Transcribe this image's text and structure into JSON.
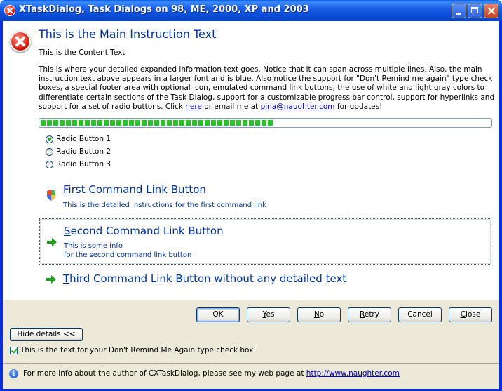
{
  "window": {
    "title": "XTaskDialog, Task Dialogs on 98, ME, 2000, XP and 2003"
  },
  "main": {
    "instruction": "This is the Main Instruction Text",
    "content": "This is the Content Text",
    "expanded_before": "This is where your detailed expanded information text goes. Notice that it can span across multiple lines. Also, the main instruction text above appears in a larger font and is blue. Also notice the support for \"Don't Remind me again\" type check boxes, a special footer area with optional icon, emulated command link buttons, the use of white and light gray colors to differentiate certain sections of the Task Dialog, support for a customizable progress bar control, support for hyperlinks and support for a set of radio buttons. Click ",
    "link_here": "here",
    "expanded_middle": " or email me at ",
    "link_email": "pjna@naughter.com",
    "expanded_after": " for updates!",
    "progress": 0.52
  },
  "radios": [
    {
      "label": "Radio Button 1",
      "checked": true
    },
    {
      "label": "Radio Button 2",
      "checked": false
    },
    {
      "label": "Radio Button 3",
      "checked": false
    }
  ],
  "commands": [
    {
      "access_key": "F",
      "title_rest": "irst Command Link Button",
      "detail1": "This is the detailed instructions for the first command link",
      "icon": "shield-icon"
    },
    {
      "access_key": "S",
      "title_rest": "econd Command Link Button",
      "detail1": "This is some info",
      "detail2": "for the second command link button",
      "icon": "arrow-icon"
    },
    {
      "access_key": "T",
      "title_rest": "hird Command Link Button without any detailed text",
      "icon": "arrow-icon"
    }
  ],
  "buttons": [
    {
      "pre": "OK",
      "key": "",
      "post": ""
    },
    {
      "pre": "",
      "key": "Y",
      "post": "es"
    },
    {
      "pre": "",
      "key": "N",
      "post": "o"
    },
    {
      "pre": "",
      "key": "R",
      "post": "etry"
    },
    {
      "pre": "Cancel",
      "key": "",
      "post": ""
    },
    {
      "pre": "",
      "key": "C",
      "post": "lose"
    }
  ],
  "details_button": "Hide details <<",
  "verification": {
    "label": "This is the text for your Don't Remind Me Again type check box!",
    "checked": true
  },
  "footer": {
    "text": "For more info about the author of CXTaskDialog, please see my web page at ",
    "link": "http://www.naughter.com"
  },
  "colors": {
    "instruction": "#003399",
    "progress": "#29c229",
    "footer_bg": "#ece9d8",
    "title_bar": "#0a5fe8"
  }
}
